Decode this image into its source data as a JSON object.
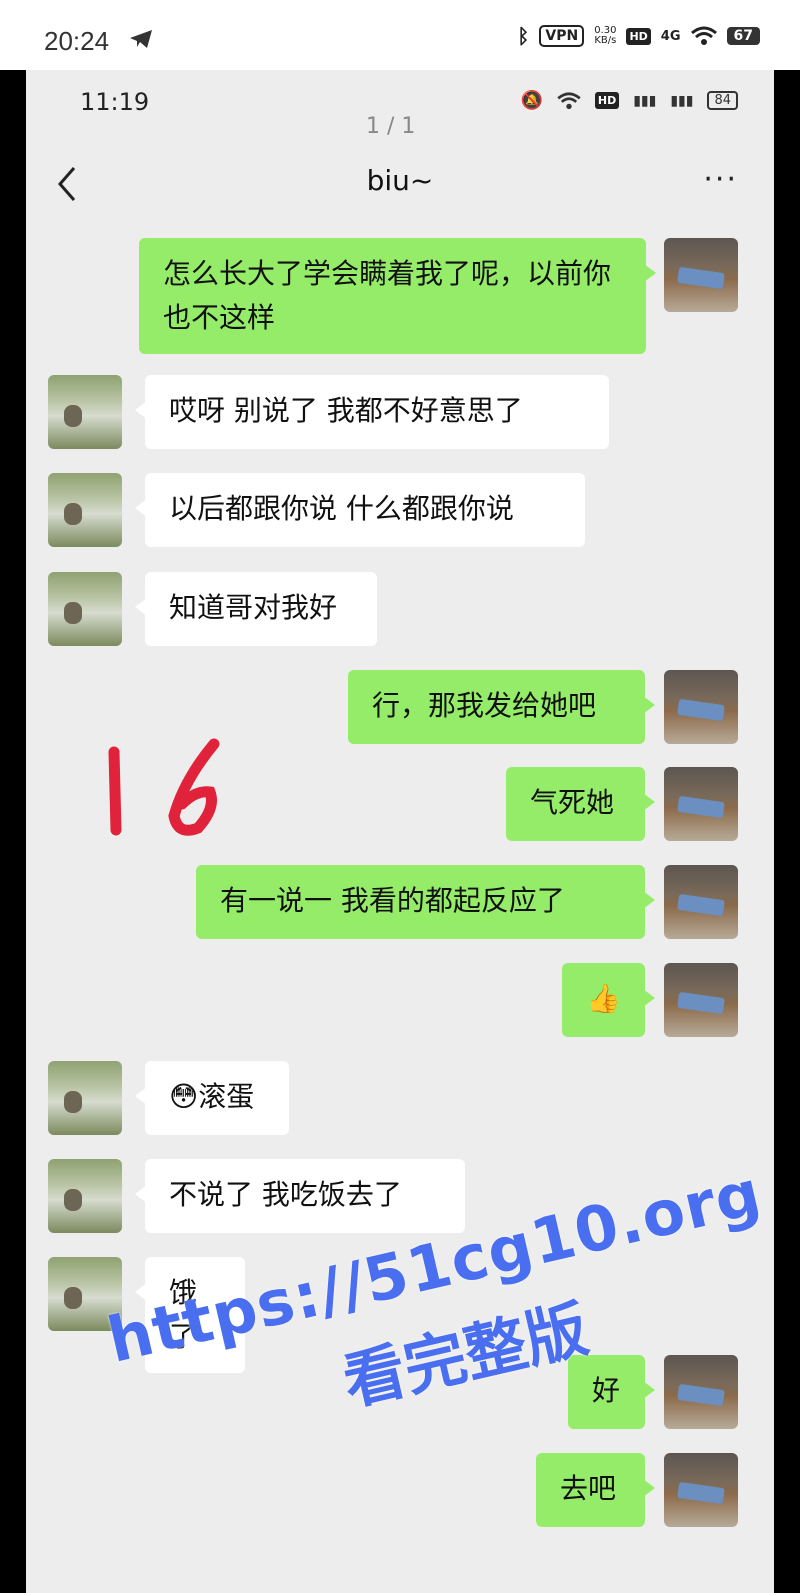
{
  "outer_status": {
    "time": "20:24",
    "vpn": "VPN",
    "speed_top": "0.30",
    "speed_bottom": "KB/s",
    "hd": "HD",
    "network": "4G",
    "battery": "67"
  },
  "inner_status": {
    "time": "11:19",
    "hd": "HD",
    "battery": "84"
  },
  "pager": "1 / 1",
  "chat": {
    "title": "biu~",
    "more": "···"
  },
  "messages": [
    {
      "from": "me",
      "text": "怎么长大了学会瞒着我了呢，以前你也不这样"
    },
    {
      "from": "them",
      "text": "哎呀  别说了   我都不好意思了"
    },
    {
      "from": "them",
      "text": "以后都跟你说  什么都跟你说"
    },
    {
      "from": "them",
      "text": "知道哥对我好"
    },
    {
      "from": "me",
      "text": "行，那我发给她吧"
    },
    {
      "from": "me",
      "text": "气死她"
    },
    {
      "from": "me",
      "text": "有一说一   我看的都起反应了"
    },
    {
      "from": "me",
      "text": "👍"
    },
    {
      "from": "them",
      "text": "😳滚蛋"
    },
    {
      "from": "them",
      "text": "不说了   我吃饭去了"
    },
    {
      "from": "them",
      "text": "饿了"
    },
    {
      "from": "me",
      "text": "好"
    },
    {
      "from": "me",
      "text": "去吧"
    }
  ],
  "handwritten_mark": "16",
  "watermark": {
    "line1": "https://51cg10.org",
    "line2": "看完整版"
  }
}
